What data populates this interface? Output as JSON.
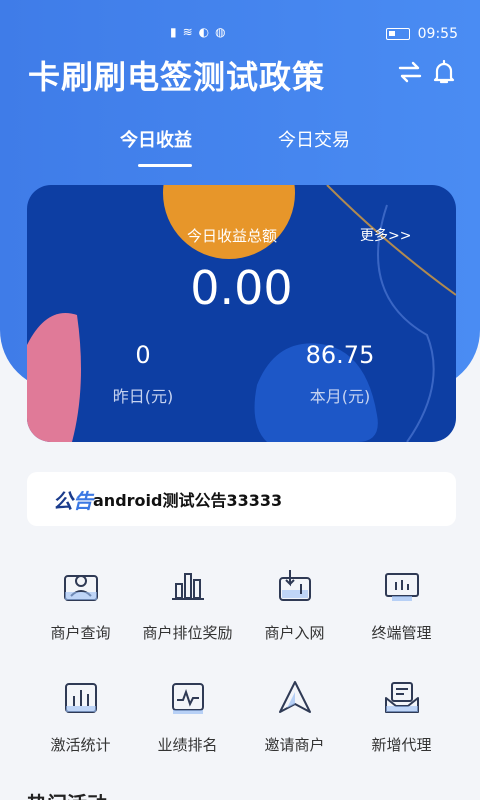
{
  "status_bar": {
    "time": "09:55"
  },
  "header": {
    "title": "卡刷刷电签测试政策"
  },
  "tabs": [
    {
      "label": "今日收益",
      "active": true
    },
    {
      "label": "今日交易",
      "active": false
    }
  ],
  "earnings_card": {
    "label": "今日收益总额",
    "more": "更多>>",
    "amount": "0.00",
    "yesterday_value": "0",
    "yesterday_label": "昨日(元)",
    "month_value": "86.75",
    "month_label": "本月(元)"
  },
  "notice": {
    "tag_part1": "公",
    "tag_part2": "告",
    "text": "android测试公告33333"
  },
  "menu": [
    {
      "label": "商户查询",
      "icon": "merchant-card-icon"
    },
    {
      "label": "商户排位奖励",
      "icon": "bar-ranking-icon"
    },
    {
      "label": "商户入网",
      "icon": "pos-terminal-icon"
    },
    {
      "label": "终端管理",
      "icon": "monitor-icon"
    },
    {
      "label": "激活统计",
      "icon": "stats-chart-icon"
    },
    {
      "label": "业绩排名",
      "icon": "pulse-monitor-icon"
    },
    {
      "label": "邀请商户",
      "icon": "triangle-navigation-icon"
    },
    {
      "label": "新增代理",
      "icon": "mail-tray-icon"
    }
  ],
  "section": {
    "title": "热门活动"
  },
  "colors": {
    "primary": "#4a8cf3",
    "card": "#0d3ea3",
    "accent_orange": "#e7962a",
    "accent_pink": "#e07a98"
  }
}
